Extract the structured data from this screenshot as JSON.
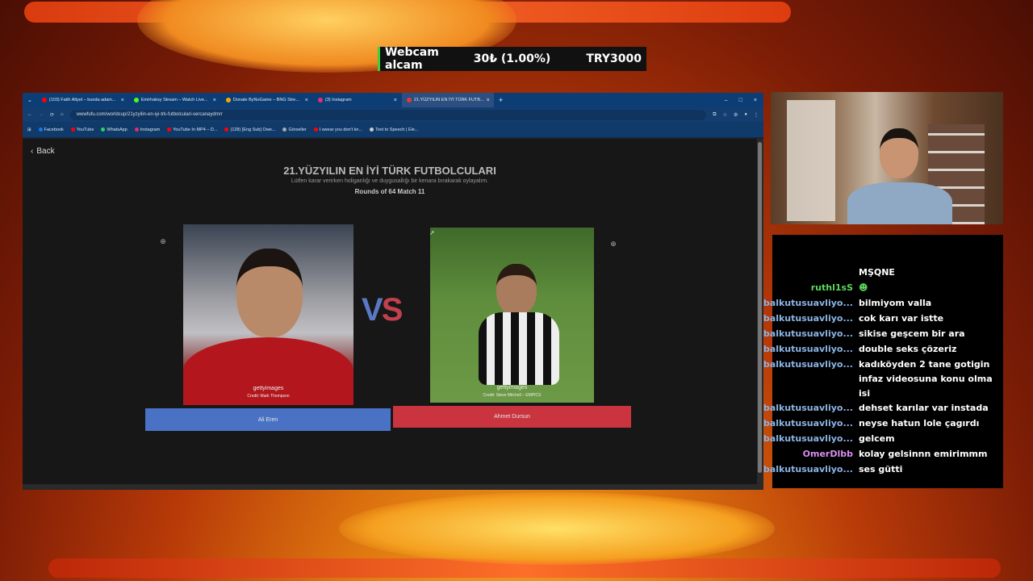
{
  "donation": {
    "message": "Webcam alcam",
    "amount": "30₺ (1.00%)",
    "goal": "TRY3000"
  },
  "browser": {
    "tabs": [
      {
        "label": "(103) Fatih Altyel – bunda adam...",
        "color": "#ff0000"
      },
      {
        "label": "Emirhaksy Stream – Watch Live...",
        "color": "#53fc18"
      },
      {
        "label": "Donate ByNoGame – BNG Stre...",
        "color": "#f7a800"
      },
      {
        "label": "(3) Instagram",
        "color": "#e1306c"
      },
      {
        "label": "21.YÜZYILIN EN İYİ TÜRK FUTB...",
        "color": "#e23a3a"
      }
    ],
    "url": "wwwfufu.com/worldcup/21yzyilin-en-iyi-trk-futbolculari-sercanaydmrr",
    "bookmarks": [
      {
        "label": "Facebook",
        "color": "#1877f2"
      },
      {
        "label": "YouTube",
        "color": "#ff0000"
      },
      {
        "label": "WhatsApp",
        "color": "#25d366"
      },
      {
        "label": "Instagram",
        "color": "#e1306c"
      },
      {
        "label": "YouTube In MP4 – D...",
        "color": "#ff0000"
      },
      {
        "label": "(128) [Eng Sub] Owe...",
        "color": "#ff0000"
      },
      {
        "label": "Görseller",
        "color": "#aaaaaa"
      },
      {
        "label": "I swear you don't kn...",
        "color": "#ff0000"
      },
      {
        "label": "Text to Speech | Ele...",
        "color": "#cccccc"
      }
    ]
  },
  "page": {
    "back_label": "Back",
    "title": "21.YÜZYILIN EN İYİ TÜRK FUTBOLCULARI",
    "subtitle": "Lütfen karar verirken holiganlığı ve duygusallığı bir kenara bırakarak oylayalım.",
    "round": "Rounds of 64 Match 11",
    "vs_left": "V",
    "vs_right": "S",
    "left": {
      "name": "Ali Eren",
      "watermark": "gettyimages",
      "credit": "Credit: Mark Thompson"
    },
    "right": {
      "name": "Ahmet Dursun",
      "watermark": "gettyimages",
      "credit": "Credit: Steve Mitchell – EMPICS"
    }
  },
  "chat": [
    {
      "user": "",
      "message": "MŞQNE",
      "color": "#ffffff"
    },
    {
      "user": "ruthl1sS",
      "message": "☻",
      "color": "#5cd65c"
    },
    {
      "user": "balkutusuavliyo...",
      "message": "bilmiyom valla",
      "color": "#8cb4e6"
    },
    {
      "user": "balkutusuavliyo...",
      "message": "cok karı var istte",
      "color": "#8cb4e6"
    },
    {
      "user": "balkutusuavliyo...",
      "message": "sikise geşcem bir ara",
      "color": "#8cb4e6"
    },
    {
      "user": "balkutusuavliyo...",
      "message": "double seks çözeriz",
      "color": "#8cb4e6"
    },
    {
      "user": "balkutusuavliyo...",
      "message": "kadıköyden 2 tane gotigin infaz videosuna konu olma isi",
      "color": "#8cb4e6"
    },
    {
      "user": "balkutusuavliyo...",
      "message": "dehset karılar var instada",
      "color": "#8cb4e6"
    },
    {
      "user": "balkutusuavliyo...",
      "message": "neyse hatun lole çagırdı",
      "color": "#8cb4e6"
    },
    {
      "user": "balkutusuavliyo...",
      "message": "gelcem",
      "color": "#8cb4e6"
    },
    {
      "user": "OmerDlbb",
      "message": "kolay gelsinnn emirimmm",
      "color": "#d98cf0"
    },
    {
      "user": "balkutusuavliyo...",
      "message": "ses gütti",
      "color": "#8cb4e6"
    }
  ]
}
